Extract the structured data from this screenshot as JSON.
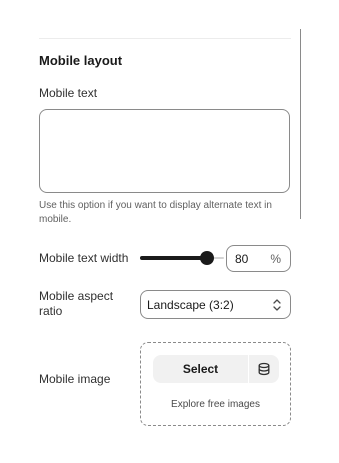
{
  "section": {
    "title": "Mobile layout"
  },
  "mobile_text": {
    "label": "Mobile text",
    "value": "",
    "help": "Use this option if you want to display alternate text in mobile."
  },
  "mobile_text_width": {
    "label": "Mobile text width",
    "value": "80",
    "suffix": "%",
    "slider_fraction": 0.8
  },
  "mobile_aspect_ratio": {
    "label": "Mobile aspect ratio",
    "selected": "Landscape (3:2)"
  },
  "mobile_image": {
    "label": "Mobile image",
    "select_label": "Select",
    "explore_label": "Explore free images",
    "library_icon": "database-icon"
  }
}
